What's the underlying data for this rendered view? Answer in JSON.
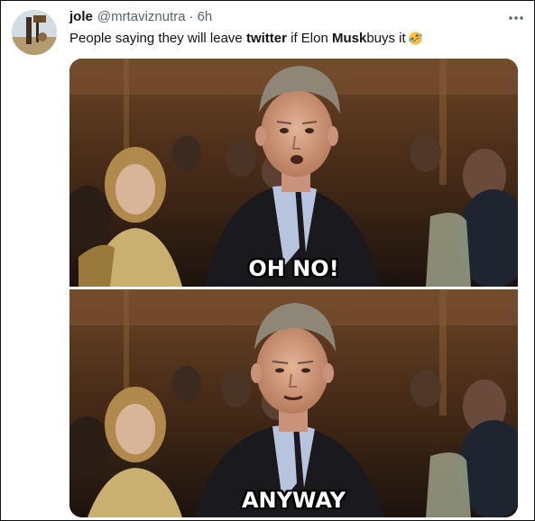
{
  "tweet": {
    "display_name": "jole",
    "handle": "@mrtaviznutra",
    "separator": "·",
    "time": "6h",
    "text_parts": {
      "p1": "People saying they will leave ",
      "p2": "twitter",
      "p3": " if Elon ",
      "p4": "Musk",
      "p5": " buys it"
    },
    "emoji": "rolling-on-floor-laughing-emoji",
    "more_icon": "more-horizontal-icon"
  },
  "meme": {
    "top_caption": "OH NO!",
    "bottom_caption": "ANYWAY"
  },
  "colors": {
    "text_primary": "#0f1419",
    "text_secondary": "#536471",
    "background": "#ffffff"
  }
}
